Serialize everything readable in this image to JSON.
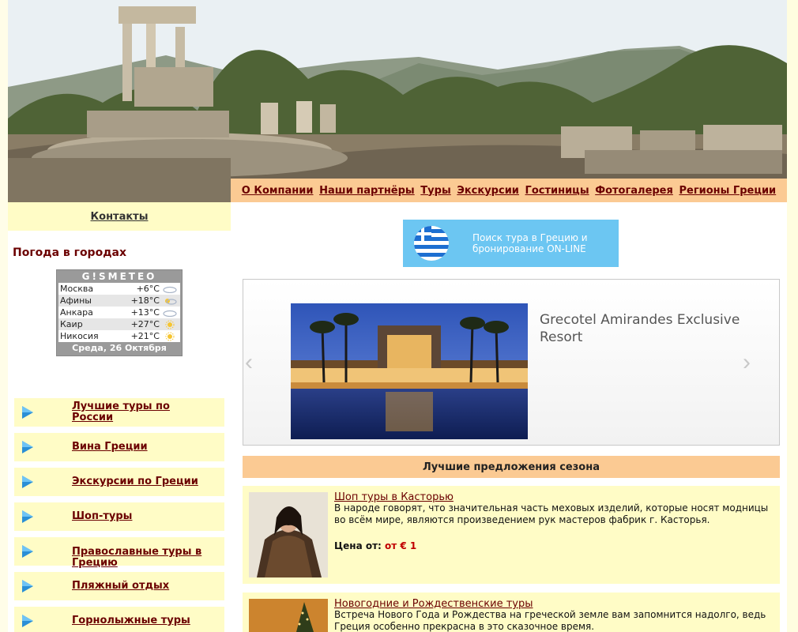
{
  "nav": {
    "items": [
      "О Компании",
      "Наши партнёры",
      "Туры",
      "Экскурсии",
      "Гостиницы",
      "Фотогалерея",
      "Регионы Греции"
    ]
  },
  "sidebar": {
    "contacts": "Контакты",
    "weather_title": "Погода в городах",
    "gismeteo": {
      "brand": "G!SMETEO",
      "rows": [
        {
          "city": "Москва",
          "temp": "+6°C",
          "icon": "cloud-icon"
        },
        {
          "city": "Афины",
          "temp": "+18°C",
          "icon": "sun-cloud-icon"
        },
        {
          "city": "Анкара",
          "temp": "+13°C",
          "icon": "cloud-icon"
        },
        {
          "city": "Каир",
          "temp": "+27°C",
          "icon": "sun-icon"
        },
        {
          "city": "Никосия",
          "temp": "+21°C",
          "icon": "sun-icon"
        }
      ],
      "date": "Среда, 26 Октября"
    },
    "menu": [
      "Лучшие туры по России",
      "Вина Греции",
      "Экскурсии по Греции",
      "Шоп-туры",
      "Православные туры в Грецию",
      "Пляжный отдых",
      "Горнолыжные туры"
    ]
  },
  "search_banner": {
    "line1": "Поиск тура в Грецию и",
    "line2": "бронирование ON-LINE"
  },
  "slider": {
    "title": "Grecotel Amirandes Exclusive Resort",
    "prev": "‹",
    "next": "›"
  },
  "offers": {
    "heading": "Лучшие предложения сезона",
    "items": [
      {
        "title": "Шоп туры в Касторью",
        "desc": "В народе говорят, что значительная часть меховых изделий, которые носят модницы во всём мире, являются произведением рук мастеров фабрик г. Касторья.",
        "price_label": "Цена от:",
        "price_value": "от € 1"
      },
      {
        "title": "Новогодние и Рождественские туры",
        "desc": "Встреча Нового Года и Рождества на греческой земле вам запомнится надолго, ведь Греция особенно прекрасна в это сказочное время."
      }
    ]
  },
  "colors": {
    "accent": "#fbca93",
    "panel": "#fffcc6",
    "link": "#6b0000",
    "banner_blue": "#6cc6f2"
  }
}
